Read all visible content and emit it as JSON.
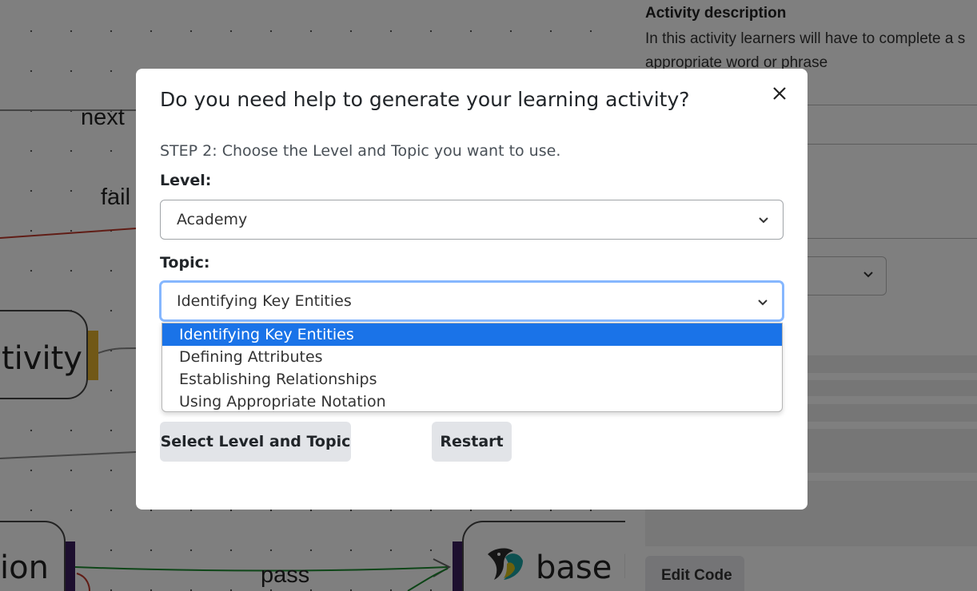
{
  "canvas": {
    "edge_labels": {
      "next": "next",
      "fail": "fail",
      "pass": "pass"
    },
    "nodes": {
      "activity": "tivity",
      "tion": "ion",
      "base": "base l"
    }
  },
  "right_panel": {
    "description_title": "Activity description",
    "description_text": "In this activity learners will have to complete a s appropriate word or phrase",
    "edit_code_label": "Edit Code"
  },
  "modal": {
    "title": "Do you need help to generate your learning activity?",
    "step_text": "STEP 2: Choose the Level and Topic you want to use.",
    "level_label": "Level:",
    "level_value": "Academy",
    "topic_label": "Topic:",
    "topic_value": "Identifying Key Entities",
    "topic_options": [
      "Identifying Key Entities",
      "Defining Attributes",
      "Establishing Relationships",
      "Using Appropriate Notation"
    ],
    "select_button": "Select Level and Topic",
    "restart_button": "Restart"
  },
  "colors": {
    "selected_option": "#1a73e8",
    "focus_border": "#86b7fe",
    "fail_edge": "#c0392b",
    "pass_edge": "#1a8a2e",
    "port_yellow": "#e3b12f",
    "port_purple": "#3b1f5e"
  },
  "icons": {
    "close": "close-icon",
    "dropdown": "chevron-down-icon",
    "logo": "bird-logo-icon"
  }
}
